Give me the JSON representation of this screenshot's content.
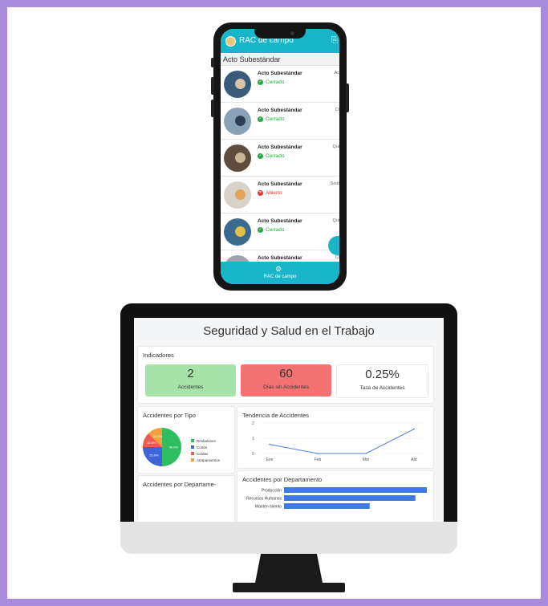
{
  "phone": {
    "app_title": "RAC de campo",
    "list_header": "Acto Subestándar",
    "rows": [
      {
        "title": "Acto Subestándar",
        "status": "Cerrado",
        "meta": "Ac",
        "closed": true
      },
      {
        "title": "Acto Subestándar",
        "status": "Cerrado",
        "meta": "Cl",
        "closed": true
      },
      {
        "title": "Acto Subestándar",
        "status": "Cerrado",
        "meta": "Qui",
        "closed": true
      },
      {
        "title": "Acto Subestándar",
        "status": "Abierto",
        "meta": "Sout",
        "closed": false
      },
      {
        "title": "Acto Subestándar",
        "status": "Cerrado",
        "meta": "Qui",
        "closed": true
      },
      {
        "title": "Acto Subestándar",
        "status": "",
        "meta": "Ci",
        "closed": true
      }
    ],
    "bottom_label": "RAC de campo",
    "colors": {
      "accent": "#19b5c8",
      "ok": "#26a63e",
      "bad": "#d93434"
    }
  },
  "dashboard": {
    "title": "Seguridad y Salud en el Trabajo",
    "indicators_title": "Indicadores",
    "kpis": [
      {
        "value": "2",
        "label": "Accidentes",
        "color": "#a6e3a9"
      },
      {
        "value": "60",
        "label": "Días sin Accidentes",
        "color": "#f37373"
      },
      {
        "value": "0.25%",
        "label": "Tasa de Accidentes",
        "color": "#ffffff"
      }
    ],
    "pie_title": "Accidentes por Tipo",
    "dept_left_title": "Accidentes por Departame-",
    "trend_title": "Tendencia de Accidentes",
    "dept_title": "Accidentes por Departamento"
  },
  "chart_data": [
    {
      "type": "pie",
      "title": "Accidentes por Tipo",
      "categories": [
        "Resbalones",
        "Cortes",
        "Caídas",
        "Atrapamientos"
      ],
      "values": [
        50,
        25.0,
        12.5,
        12.5
      ],
      "slice_labels": [
        "50.0%",
        "25.0%",
        "12.5%",
        "12.5%"
      ],
      "colors": [
        "#2ebd5f",
        "#3f63d9",
        "#ef5b4d",
        "#f4a13b"
      ],
      "legend": "right"
    },
    {
      "type": "line",
      "title": "Tendencia de Accidentes",
      "categories": [
        "Ene",
        "Feb",
        "Mar",
        "Abr"
      ],
      "values": [
        0.6,
        0,
        0,
        1.6
      ],
      "yticks": [
        "0",
        "1",
        "2"
      ],
      "ylim": [
        0,
        2
      ],
      "color": "#4a7fd6"
    },
    {
      "type": "bar",
      "orientation": "horizontal",
      "title": "Accidentes por Departamento",
      "categories": [
        "Producción",
        "Recursos Humanos",
        "Manten miento"
      ],
      "values": [
        1,
        0.92,
        0.6
      ],
      "color": "#3f79e6"
    }
  ]
}
